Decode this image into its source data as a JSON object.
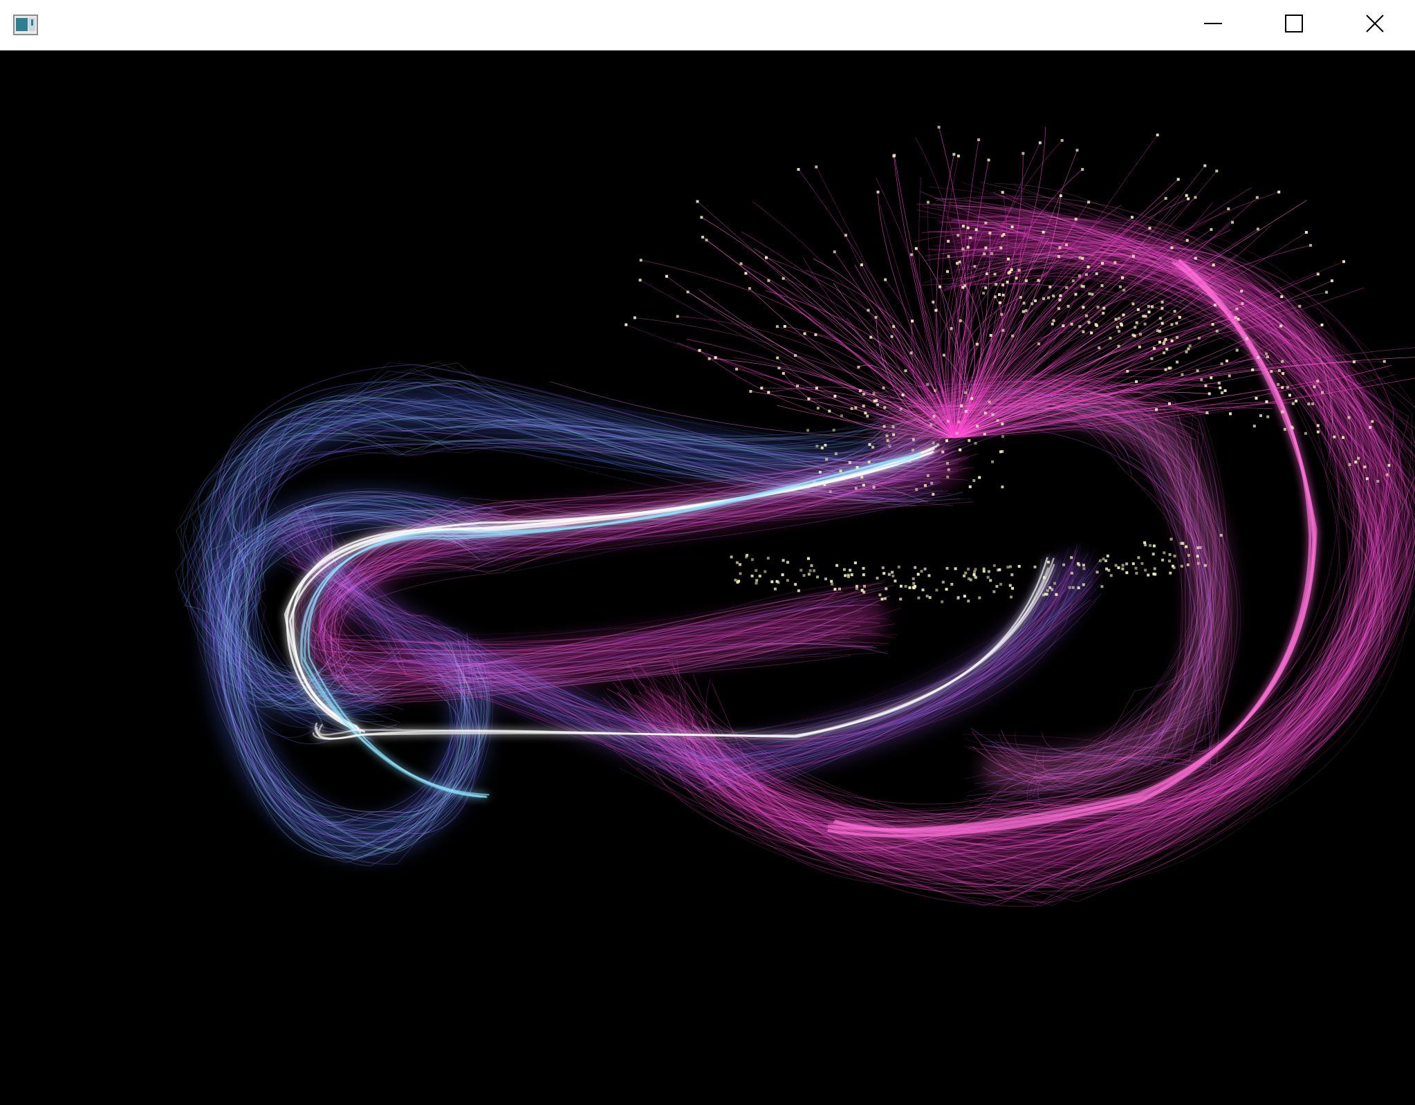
{
  "window": {
    "title": "",
    "controls": {
      "minimize_icon": "minimize-icon",
      "maximize_icon": "maximize-icon",
      "close_icon": "close-icon"
    }
  },
  "canvas": {
    "background_color": "#000000",
    "palette": {
      "blue": "#5a78ff",
      "cyan": "#8fe3ff",
      "violet": "#a15bff",
      "magenta": "#ff3ccf",
      "pink": "#ff6fd8",
      "white_core": "#ffffff",
      "particle": "#f3edb8"
    }
  }
}
